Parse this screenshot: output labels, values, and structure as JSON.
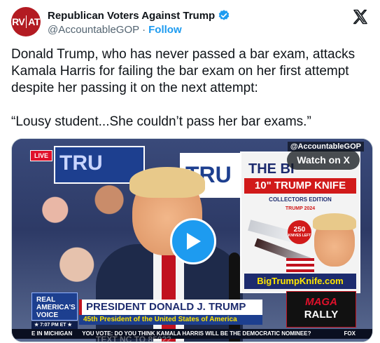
{
  "author": {
    "avatar_text_left": "RV",
    "avatar_text_right": "AT",
    "display_name": "Republican Voters Against Trump",
    "handle": "@AccountableGOP",
    "separator": "·",
    "follow_label": "Follow",
    "verified_icon": "verified-badge-icon",
    "avatar_color": "#b31b22"
  },
  "platform_icon": "x-logo-icon",
  "tweet": {
    "paragraph_1": "Donald Trump, who has never passed a bar exam, attacks Kamala Harris for failing the bar exam on her first attempt despite her passing it on the next attempt:",
    "paragraph_2": "“Lousy student...She couldn’t pass her bar exams.”"
  },
  "video": {
    "live_label": "LIVE",
    "watermark": "@AccountableGOP",
    "watch_on_x_label": "Watch on X",
    "play_icon": "play-icon",
    "accent_color": "#1d9bf0",
    "background_signs": [
      "TRU",
      "TRU"
    ],
    "ad": {
      "title_line1": "THE BI",
      "title_line2": "10\" TRUMP KNIFE",
      "title_line3": "COLLECTORS EDITION",
      "title_line4": "TRUMP 2024",
      "badge_number": "250",
      "badge_text": "KNIVES LEFT",
      "url": "BigTrumpKnife.com"
    },
    "lower_third": {
      "network_logo": "REAL AMERICA'S VOICE",
      "time": "★ 7:07 PM ET ★",
      "name": "PRESIDENT DONALD J. TRUMP",
      "subtitle": "45th President of the United States of America",
      "maga_top": "MAGA",
      "maga_bottom": "RALLY",
      "ticker_left": "E IN MICHIGAN",
      "ticker_poll": "YOU VOTE: DO YOU THINK KAMALA HARRIS WILL BE THE DEMOCRATIC NOMINEE?",
      "ticker_right": "FOX",
      "bottom_strip": "TEXT NC TO 85022"
    }
  }
}
